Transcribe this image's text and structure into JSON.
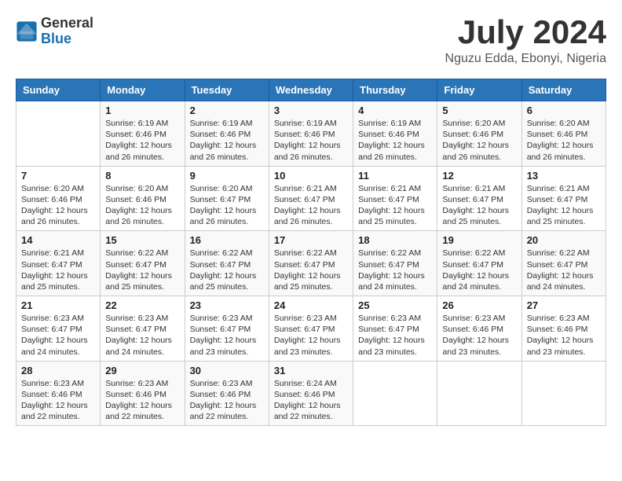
{
  "header": {
    "logo_general": "General",
    "logo_blue": "Blue",
    "month_title": "July 2024",
    "location": "Nguzu Edda, Ebonyi, Nigeria"
  },
  "days_of_week": [
    "Sunday",
    "Monday",
    "Tuesday",
    "Wednesday",
    "Thursday",
    "Friday",
    "Saturday"
  ],
  "weeks": [
    [
      {
        "num": "",
        "info": ""
      },
      {
        "num": "1",
        "info": "Sunrise: 6:19 AM\nSunset: 6:46 PM\nDaylight: 12 hours\nand 26 minutes."
      },
      {
        "num": "2",
        "info": "Sunrise: 6:19 AM\nSunset: 6:46 PM\nDaylight: 12 hours\nand 26 minutes."
      },
      {
        "num": "3",
        "info": "Sunrise: 6:19 AM\nSunset: 6:46 PM\nDaylight: 12 hours\nand 26 minutes."
      },
      {
        "num": "4",
        "info": "Sunrise: 6:19 AM\nSunset: 6:46 PM\nDaylight: 12 hours\nand 26 minutes."
      },
      {
        "num": "5",
        "info": "Sunrise: 6:20 AM\nSunset: 6:46 PM\nDaylight: 12 hours\nand 26 minutes."
      },
      {
        "num": "6",
        "info": "Sunrise: 6:20 AM\nSunset: 6:46 PM\nDaylight: 12 hours\nand 26 minutes."
      }
    ],
    [
      {
        "num": "7",
        "info": "Sunrise: 6:20 AM\nSunset: 6:46 PM\nDaylight: 12 hours\nand 26 minutes."
      },
      {
        "num": "8",
        "info": "Sunrise: 6:20 AM\nSunset: 6:46 PM\nDaylight: 12 hours\nand 26 minutes."
      },
      {
        "num": "9",
        "info": "Sunrise: 6:20 AM\nSunset: 6:47 PM\nDaylight: 12 hours\nand 26 minutes."
      },
      {
        "num": "10",
        "info": "Sunrise: 6:21 AM\nSunset: 6:47 PM\nDaylight: 12 hours\nand 26 minutes."
      },
      {
        "num": "11",
        "info": "Sunrise: 6:21 AM\nSunset: 6:47 PM\nDaylight: 12 hours\nand 25 minutes."
      },
      {
        "num": "12",
        "info": "Sunrise: 6:21 AM\nSunset: 6:47 PM\nDaylight: 12 hours\nand 25 minutes."
      },
      {
        "num": "13",
        "info": "Sunrise: 6:21 AM\nSunset: 6:47 PM\nDaylight: 12 hours\nand 25 minutes."
      }
    ],
    [
      {
        "num": "14",
        "info": "Sunrise: 6:21 AM\nSunset: 6:47 PM\nDaylight: 12 hours\nand 25 minutes."
      },
      {
        "num": "15",
        "info": "Sunrise: 6:22 AM\nSunset: 6:47 PM\nDaylight: 12 hours\nand 25 minutes."
      },
      {
        "num": "16",
        "info": "Sunrise: 6:22 AM\nSunset: 6:47 PM\nDaylight: 12 hours\nand 25 minutes."
      },
      {
        "num": "17",
        "info": "Sunrise: 6:22 AM\nSunset: 6:47 PM\nDaylight: 12 hours\nand 25 minutes."
      },
      {
        "num": "18",
        "info": "Sunrise: 6:22 AM\nSunset: 6:47 PM\nDaylight: 12 hours\nand 24 minutes."
      },
      {
        "num": "19",
        "info": "Sunrise: 6:22 AM\nSunset: 6:47 PM\nDaylight: 12 hours\nand 24 minutes."
      },
      {
        "num": "20",
        "info": "Sunrise: 6:22 AM\nSunset: 6:47 PM\nDaylight: 12 hours\nand 24 minutes."
      }
    ],
    [
      {
        "num": "21",
        "info": "Sunrise: 6:23 AM\nSunset: 6:47 PM\nDaylight: 12 hours\nand 24 minutes."
      },
      {
        "num": "22",
        "info": "Sunrise: 6:23 AM\nSunset: 6:47 PM\nDaylight: 12 hours\nand 24 minutes."
      },
      {
        "num": "23",
        "info": "Sunrise: 6:23 AM\nSunset: 6:47 PM\nDaylight: 12 hours\nand 23 minutes."
      },
      {
        "num": "24",
        "info": "Sunrise: 6:23 AM\nSunset: 6:47 PM\nDaylight: 12 hours\nand 23 minutes."
      },
      {
        "num": "25",
        "info": "Sunrise: 6:23 AM\nSunset: 6:47 PM\nDaylight: 12 hours\nand 23 minutes."
      },
      {
        "num": "26",
        "info": "Sunrise: 6:23 AM\nSunset: 6:46 PM\nDaylight: 12 hours\nand 23 minutes."
      },
      {
        "num": "27",
        "info": "Sunrise: 6:23 AM\nSunset: 6:46 PM\nDaylight: 12 hours\nand 23 minutes."
      }
    ],
    [
      {
        "num": "28",
        "info": "Sunrise: 6:23 AM\nSunset: 6:46 PM\nDaylight: 12 hours\nand 22 minutes."
      },
      {
        "num": "29",
        "info": "Sunrise: 6:23 AM\nSunset: 6:46 PM\nDaylight: 12 hours\nand 22 minutes."
      },
      {
        "num": "30",
        "info": "Sunrise: 6:23 AM\nSunset: 6:46 PM\nDaylight: 12 hours\nand 22 minutes."
      },
      {
        "num": "31",
        "info": "Sunrise: 6:24 AM\nSunset: 6:46 PM\nDaylight: 12 hours\nand 22 minutes."
      },
      {
        "num": "",
        "info": ""
      },
      {
        "num": "",
        "info": ""
      },
      {
        "num": "",
        "info": ""
      }
    ]
  ]
}
